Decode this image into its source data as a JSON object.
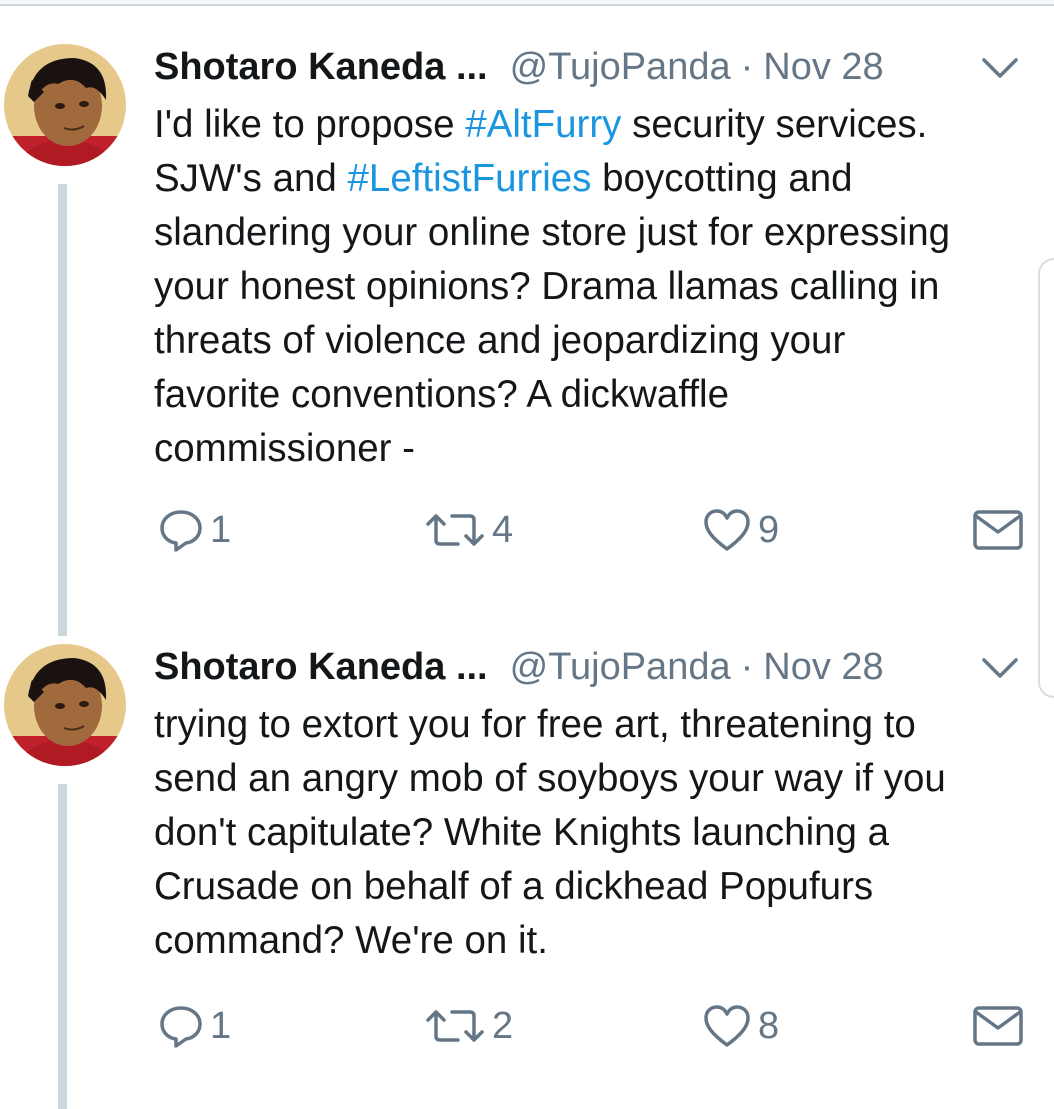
{
  "tweets": [
    {
      "author_name": "Shotaro Kaneda ...",
      "handle": "@TujoPanda",
      "separator": "·",
      "date": "Nov 28",
      "lines": [
        [
          {
            "t": "I'd like to propose "
          },
          {
            "t": "#AltFurry",
            "tag": true
          },
          {
            "t": " security services."
          }
        ],
        [
          {
            "t": "SJW's and "
          },
          {
            "t": "#LeftistFurries",
            "tag": true
          },
          {
            "t": " boycotting and"
          }
        ],
        [
          {
            "t": "slandering your online store just for expressing"
          }
        ],
        [
          {
            "t": "your honest opinions? Drama llamas calling in"
          }
        ],
        [
          {
            "t": "threats of violence and jeopardizing your"
          }
        ],
        [
          {
            "t": "favorite conventions? A dickwaffle"
          }
        ],
        [
          {
            "t": "commissioner -"
          }
        ]
      ],
      "reply_count": "1",
      "retweet_count": "4",
      "like_count": "9"
    },
    {
      "author_name": "Shotaro Kaneda ...",
      "handle": "@TujoPanda",
      "separator": "·",
      "date": "Nov 28",
      "lines": [
        [
          {
            "t": "trying to extort you for free art, threatening to"
          }
        ],
        [
          {
            "t": "send an angry mob of soyboys your way if you"
          }
        ],
        [
          {
            "t": "don't capitulate? White Knights launching a"
          }
        ],
        [
          {
            "t": "Crusade on behalf of a dickhead Popufurs"
          }
        ],
        [
          {
            "t": "command? We're on it."
          }
        ]
      ],
      "reply_count": "1",
      "retweet_count": "2",
      "like_count": "8"
    }
  ],
  "icons": {
    "reply": "reply-icon",
    "retweet": "retweet-icon",
    "like": "heart-icon",
    "dm": "envelope-icon",
    "caret": "chevron-down-icon"
  },
  "colors": {
    "link": "#1b95e0",
    "muted": "#657786",
    "thread_line": "#ccd6dd",
    "text": "#14171a"
  }
}
